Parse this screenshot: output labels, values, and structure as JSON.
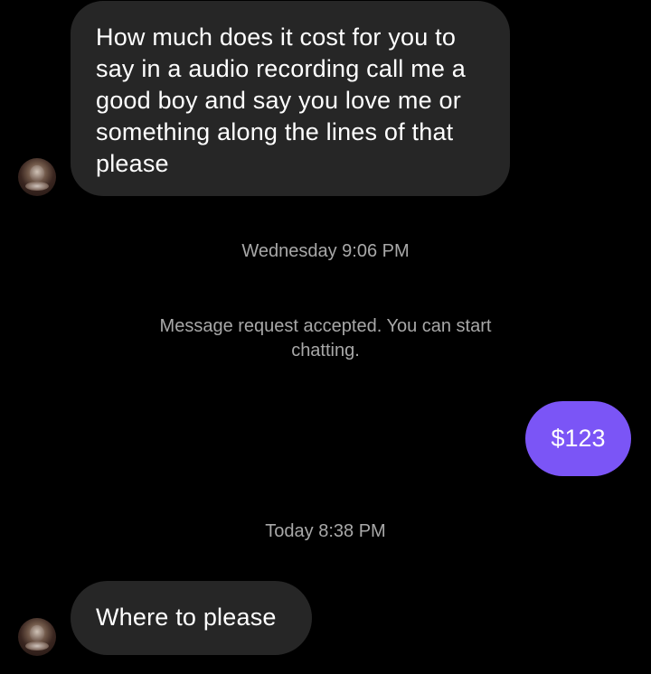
{
  "messages": {
    "incoming_1": {
      "text": "How much does it cost for you to say in a audio recording call me a good boy and say you love me or something along the lines of that please"
    },
    "timestamp_1": "Wednesday 9:06 PM",
    "system_notice": "Message request accepted. You can start chatting.",
    "outgoing_1": {
      "text": "$123"
    },
    "timestamp_2": "Today 8:38 PM",
    "incoming_2": {
      "text": "Where to please"
    }
  },
  "colors": {
    "background": "#000000",
    "incoming_bubble": "#262626",
    "outgoing_bubble": "#7b55f6",
    "meta_text": "#a8a8a8"
  },
  "icons": {
    "sender_avatar": "profile-photo-avatar"
  }
}
